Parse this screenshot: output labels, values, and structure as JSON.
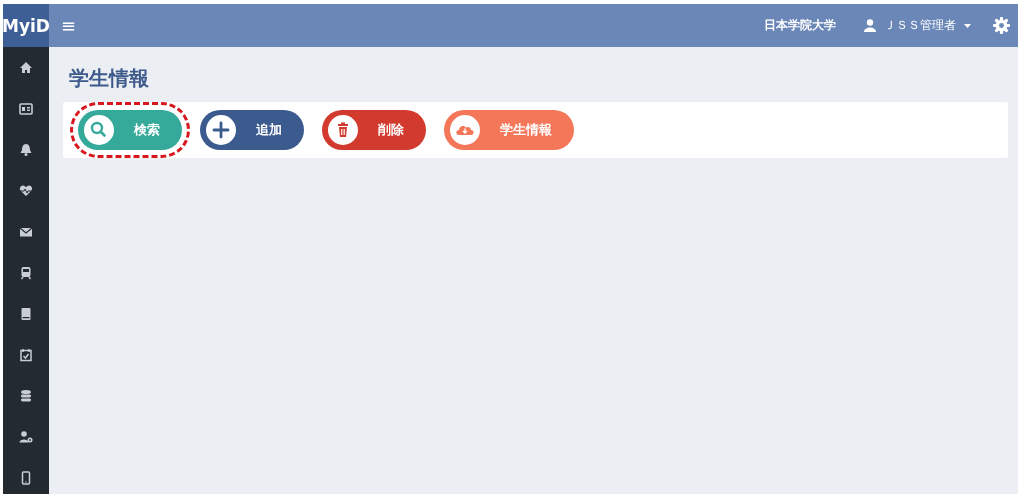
{
  "header": {
    "logo": "MyiD",
    "menu_icon": "≡",
    "organization": "日本学院大学",
    "user": "ＪＳＳ管理者"
  },
  "sidebar": {
    "items": [
      {
        "kind": "home"
      },
      {
        "kind": "card"
      },
      {
        "kind": "bell"
      },
      {
        "kind": "heart"
      },
      {
        "kind": "mail"
      },
      {
        "kind": "train"
      },
      {
        "kind": "book"
      },
      {
        "kind": "calendar"
      },
      {
        "kind": "database"
      },
      {
        "kind": "usergear"
      },
      {
        "kind": "phone"
      }
    ]
  },
  "page": {
    "title": "学生情報"
  },
  "buttons": [
    {
      "label": "検索",
      "kind": "search",
      "highlighted": true
    },
    {
      "label": "追加",
      "kind": "add",
      "highlighted": false
    },
    {
      "label": "削除",
      "kind": "delete",
      "highlighted": false
    },
    {
      "label": "学生情報",
      "kind": "download",
      "highlighted": false
    }
  ]
}
